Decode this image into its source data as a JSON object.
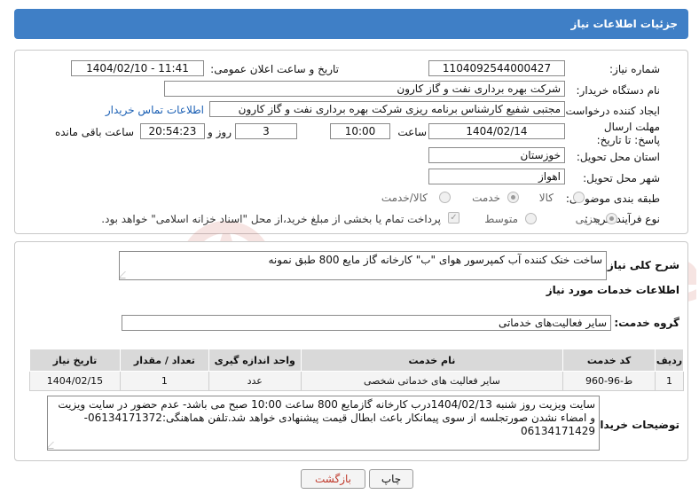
{
  "header": {
    "title": "جزئیات اطلاعات نیاز"
  },
  "fields": {
    "need_number_label": "شماره نیاز:",
    "need_number": "1104092544000427",
    "announce_label": "تاریخ و ساعت اعلان عمومی:",
    "announce_value": "1404/02/10 - 11:41",
    "buyer_label": "نام دستگاه خریدار:",
    "buyer_value": "شرکت بهره برداری نفت و گاز کارون",
    "requester_label": "ایجاد کننده درخواست:",
    "requester_value": "مجتبی شفیع کارشناس برنامه ریزی شرکت بهره برداری نفت و گاز کارون",
    "contact_link": "اطلاعات تماس خریدار",
    "deadline_label": "مهلت ارسال پاسخ: تا تاریخ:",
    "deadline_date": "1404/02/14",
    "time_label": "ساعت",
    "deadline_time": "10:00",
    "days_value": "3",
    "days_label": "روز و",
    "remaining_time": "20:54:23",
    "remaining_label": "ساعت باقی مانده",
    "province_label": "استان محل تحویل:",
    "province_value": "خوزستان",
    "city_label": "شهر محل تحویل:",
    "city_value": "اهواز",
    "category_label": "طبقه بندی موضوعی:",
    "category_options": [
      "کالا",
      "خدمت",
      "کالا/خدمت"
    ],
    "category_selected": "خدمت",
    "process_label": "نوع فرآیند خرید :",
    "process_options": [
      "جزیی",
      "متوسط"
    ],
    "process_selected": "جزیی",
    "payment_note": "پرداخت تمام یا بخشی از مبلغ خرید،از محل \"اسناد خزانه اسلامی\" خواهد بود."
  },
  "summary": {
    "label": "شرح کلی نیاز:",
    "value": "ساخت خنک کننده آب کمپرسور هوای \"ب\" کارخانه گاز مایع 800 طبق نمونه"
  },
  "services_section": {
    "title": "اطلاعات خدمات مورد نیاز",
    "group_label": "گروه خدمت:",
    "group_value": "سایر فعالیت‌های خدماتی"
  },
  "table": {
    "headers": [
      "ردیف",
      "کد خدمت",
      "نام خدمت",
      "واحد اندازه گیری",
      "تعداد / مقدار",
      "تاریخ نیاز"
    ],
    "rows": [
      [
        "1",
        "ط-96-960",
        "سایر فعالیت های خدماتی شخصی",
        "عدد",
        "1",
        "1404/02/15"
      ]
    ]
  },
  "buyer_notes": {
    "label": "توضیحات خریدار:",
    "value": "سایت ویزیت روز شنبه 1404/02/13درب کارخانه گازمایع 800 ساعت 10:00 صبح می باشد- عدم حضور در سایت ویزیت و امضاء نشدن صورتجلسه از سوی پیمانکار باعث ابطال قیمت پیشنهادی خواهد شد.تلفن هماهنگی:06134171372-06134171429"
  },
  "buttons": {
    "print": "چاپ",
    "back": "بازگشت"
  },
  "watermark": {
    "text": "AriaTender.neT"
  },
  "colors": {
    "header": "#3f7fc6",
    "link": "#1a5fb4",
    "back_text": "#c0392b",
    "watermark": "#c0392b"
  }
}
